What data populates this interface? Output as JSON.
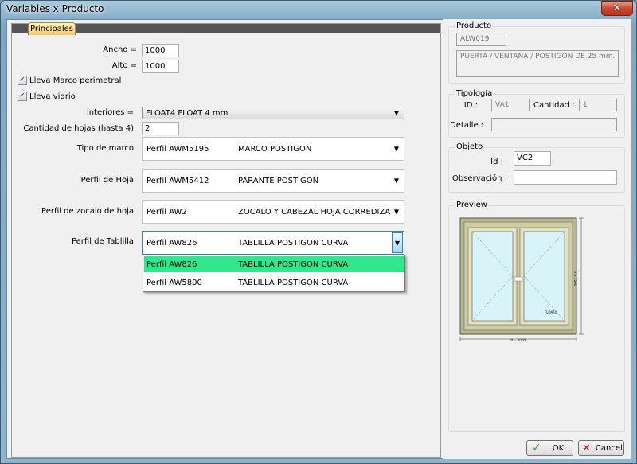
{
  "window": {
    "title": "Variables x Producto",
    "close_glyph": "✕"
  },
  "tab": {
    "label": "Principales"
  },
  "form": {
    "ancho": {
      "label": "Ancho =",
      "value": "1000"
    },
    "alto": {
      "label": "Alto =",
      "value": "1000"
    },
    "marco_perimetral": {
      "label": "Lleva Marco perimetral",
      "checked": true
    },
    "vidrio": {
      "label": "Lleva vidrio",
      "checked": true
    },
    "interiores": {
      "label": "Interiores =",
      "value": "FLOAT4 FLOAT 4 mm"
    },
    "cantidad_hojas": {
      "label": "Cantidad de hojas (hasta 4)",
      "value": "2"
    },
    "tipo_marco": {
      "label": "Tipo  de marco",
      "code": "Perfil AWM5195",
      "desc": "MARCO POSTIGON"
    },
    "perfil_hoja": {
      "label": "Perfil de Hoja",
      "code": "Perfil AWM5412",
      "desc": "PARANTE POSTIGON"
    },
    "perfil_zocalo": {
      "label": "Perfil de zocalo de hoja",
      "code": "Perfil AW2",
      "desc": "ZOCALO Y CABEZAL HOJA CORREDIZA"
    },
    "perfil_tablilla": {
      "label": "Perfil de Tablilla",
      "code": "Perfil AW826",
      "desc": "TABLILLA POSTIGON CURVA",
      "options": [
        {
          "code": "Perfil AW826",
          "desc": "TABLILLA POSTIGON CURVA"
        },
        {
          "code": "Perfil AW5800",
          "desc": "TABLILLA POSTIGON CURVA"
        }
      ]
    }
  },
  "producto": {
    "title": "Producto",
    "code": "ALW019",
    "description": "PUERTA / VENTANA / POSTIGON DE 25 mm."
  },
  "tipologia": {
    "title": "Tipología",
    "id_label": "ID :",
    "id_value": "VA1",
    "cantidad_label": "Cantidad :",
    "cantidad_value": "1",
    "detalle_label": "Detalle :",
    "detalle_value": ""
  },
  "objeto": {
    "title": "Objeto",
    "id_label": "Id :",
    "id_value": "VC2",
    "obs_label": "Observación :",
    "obs_value": ""
  },
  "preview": {
    "title": "Preview",
    "width_dim": "W = 1000",
    "height_dim": "H = 1000",
    "hoja_label": "FLOAT4"
  },
  "buttons": {
    "ok": "OK",
    "cancel": "Cancel"
  },
  "colors": {
    "selection": "#2ee98c",
    "frame": "#b8b68c",
    "glass": "#d8f4f8"
  }
}
